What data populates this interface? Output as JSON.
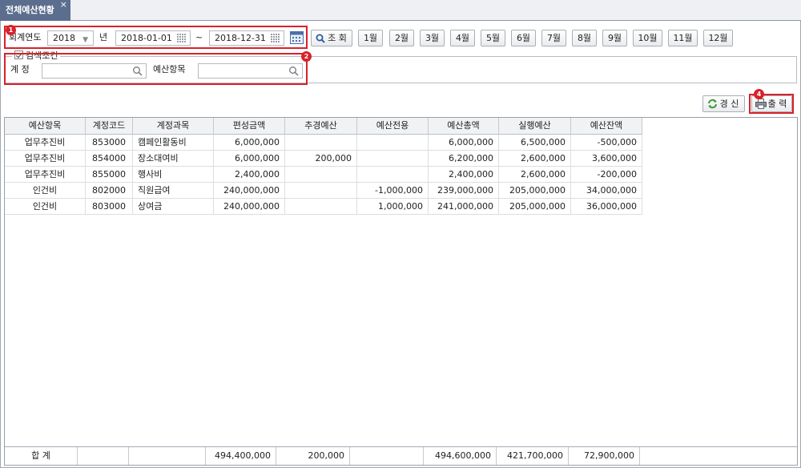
{
  "tab": {
    "title": "전체예산현황",
    "close": "×"
  },
  "filters": {
    "fiscal_year_label": "회계연도",
    "fiscal_year_value": "2018",
    "year_suffix": "년",
    "date_from": "2018-01-01",
    "date_sep": "~",
    "date_to": "2018-12-31",
    "search_button": "조 회",
    "months": [
      "1월",
      "2월",
      "3월",
      "4월",
      "5월",
      "6월",
      "7월",
      "8월",
      "9월",
      "10월",
      "11월",
      "12월"
    ]
  },
  "search_conditions": {
    "legend": "검색조건",
    "account_label": "계 정",
    "account_value": "",
    "budget_item_label": "예산항목",
    "budget_item_value": ""
  },
  "toolbar": {
    "refresh_label": "경 신",
    "print_label": "출 력"
  },
  "badges": [
    "1",
    "2",
    "4"
  ],
  "grid": {
    "columns": [
      "예산항목",
      "계정코드",
      "계정과목",
      "편성금액",
      "추경예산",
      "예산전용",
      "예산총액",
      "실행예산",
      "예산잔액"
    ],
    "rows": [
      [
        "업무추진비",
        "853000",
        "캠페인활동비",
        "6,000,000",
        "",
        "",
        "6,000,000",
        "6,500,000",
        "-500,000"
      ],
      [
        "업무추진비",
        "854000",
        "장소대여비",
        "6,000,000",
        "200,000",
        "",
        "6,200,000",
        "2,600,000",
        "3,600,000"
      ],
      [
        "업무추진비",
        "855000",
        "행사비",
        "2,400,000",
        "",
        "",
        "2,400,000",
        "2,600,000",
        "-200,000"
      ],
      [
        "인건비",
        "802000",
        "직원급여",
        "240,000,000",
        "",
        "-1,000,000",
        "239,000,000",
        "205,000,000",
        "34,000,000"
      ],
      [
        "인건비",
        "803000",
        "상여금",
        "240,000,000",
        "",
        "1,000,000",
        "241,000,000",
        "205,000,000",
        "36,000,000"
      ]
    ],
    "footer": {
      "label": "합 계",
      "values": [
        "",
        "",
        "494,400,000",
        "200,000",
        "",
        "494,600,000",
        "421,700,000",
        "72,900,000"
      ]
    }
  },
  "colors": {
    "accent_red": "#d8222a",
    "tab_bg": "#5c6e8e"
  }
}
